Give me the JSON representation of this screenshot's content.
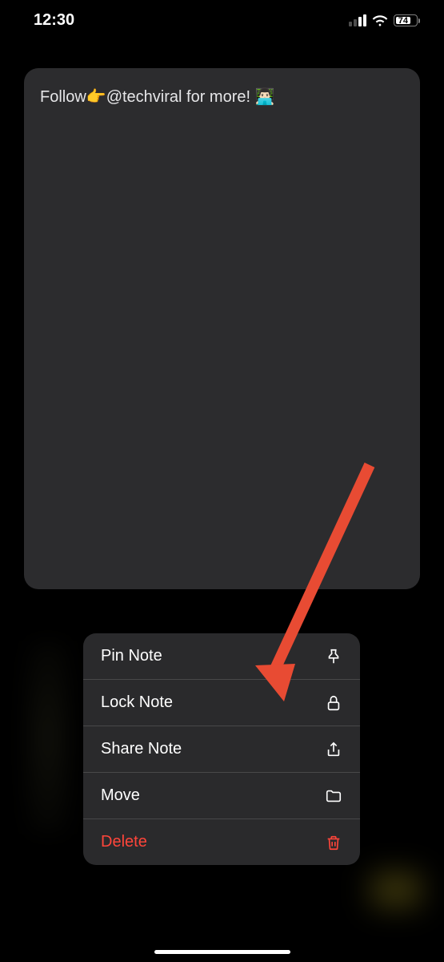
{
  "statusBar": {
    "time": "12:30",
    "battery": "74"
  },
  "note": {
    "content": "Follow👉@techviral for more! 👨🏻‍💻"
  },
  "menu": {
    "pin": "Pin Note",
    "lock": "Lock Note",
    "share": "Share Note",
    "move": "Move",
    "delete": "Delete"
  }
}
